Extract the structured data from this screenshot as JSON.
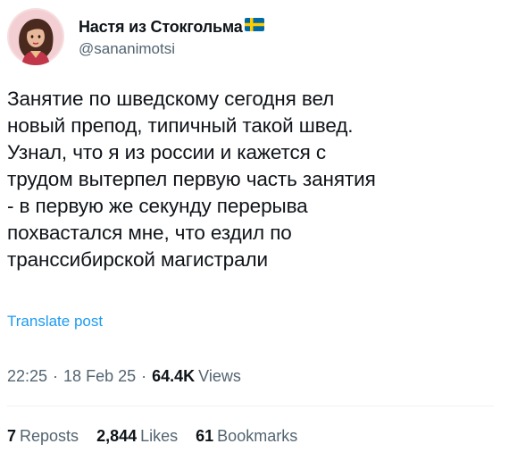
{
  "author": {
    "display_name": "Настя из Стокгольма",
    "flag_icon": "swedish-flag",
    "handle": "@sananimotsi"
  },
  "post": {
    "text": "Занятие по шведскому сегодня вел\nновый препод, типичный такой швед.\nУзнал, что я из россии и кажется с\nтрудом вытерпел первую часть занятия\n- в первую же секунду перерыва\nпохвастался мне, что ездил по\nтранссибирской магистрали",
    "translate_label": "Translate post"
  },
  "meta": {
    "time": "22:25",
    "separator": "·",
    "date": "18 Feb 25",
    "views_count": "64.4K",
    "views_label": "Views"
  },
  "stats": {
    "reposts_count": "7",
    "reposts_label": "Reposts",
    "likes_count": "2,844",
    "likes_label": "Likes",
    "bookmarks_count": "61",
    "bookmarks_label": "Bookmarks"
  },
  "colors": {
    "link": "#1d9bf0",
    "secondary_text": "#536471",
    "primary_text": "#0f1419"
  }
}
